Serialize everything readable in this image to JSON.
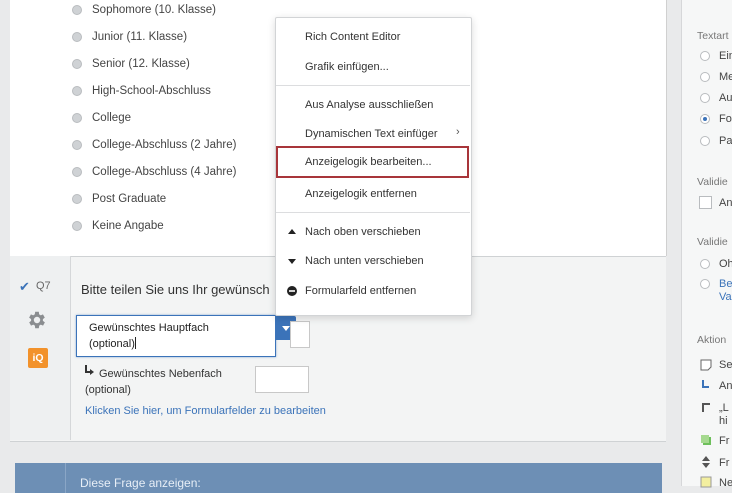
{
  "answer_options": [
    "Sophomore (10. Klasse)",
    "Junior (11. Klasse)",
    "Senior (12. Klasse)",
    "High-School-Abschluss",
    "College",
    "College-Abschluss (2 Jahre)",
    "College-Abschluss (4 Jahre)",
    "Post Graduate",
    "Keine Angabe"
  ],
  "question": {
    "number": "Q7",
    "text": "Bitte teilen Sie uns Ihr gewünsch",
    "field1_value_line1": "Gewünschtes Hauptfach",
    "field1_value_line2": "(optional)",
    "field2_label_line1": "Gewünschtes Nebenfach",
    "field2_label_line2": "(optional)",
    "edit_fields_link": "Klicken Sie hier, um Formularfelder zu bearbeiten",
    "iq_badge": "iQ"
  },
  "display_logic_banner": "Diese Frage anzeigen:",
  "context_menu": {
    "rich_content_editor": "Rich Content Editor",
    "insert_graphic": "Grafik einfügen...",
    "exclude_from_analysis": "Aus Analyse ausschließen",
    "dynamic_text": "Dynamischen Text einfüger",
    "edit_display_logic": "Anzeigelogik bearbeiten...",
    "remove_display_logic": "Anzeigelogik entfernen",
    "move_up": "Nach oben verschieben",
    "move_down": "Nach unten verschieben",
    "remove_form_field": "Formularfeld entfernen"
  },
  "right_panel": {
    "text_type_heading": "Textart",
    "text_type_options": [
      "Ein",
      "Me",
      "Au",
      "Fo",
      "Pa"
    ],
    "validation1_heading": "Validie",
    "validation1_option": "An",
    "validation2_heading": "Validie",
    "validation2_option": "Oh",
    "validation2_link_line1": "Be",
    "validation2_link_line2": "Va",
    "actions_heading": "Aktion",
    "actions": [
      "Se",
      "An",
      "„L",
      "hi",
      "Fr",
      "Fr",
      "Ne"
    ]
  },
  "colors": {
    "accent": "#3b73b9",
    "highlight_border": "#a8353a",
    "iq_orange": "#f2922b",
    "banner": "#6d8fb5"
  }
}
